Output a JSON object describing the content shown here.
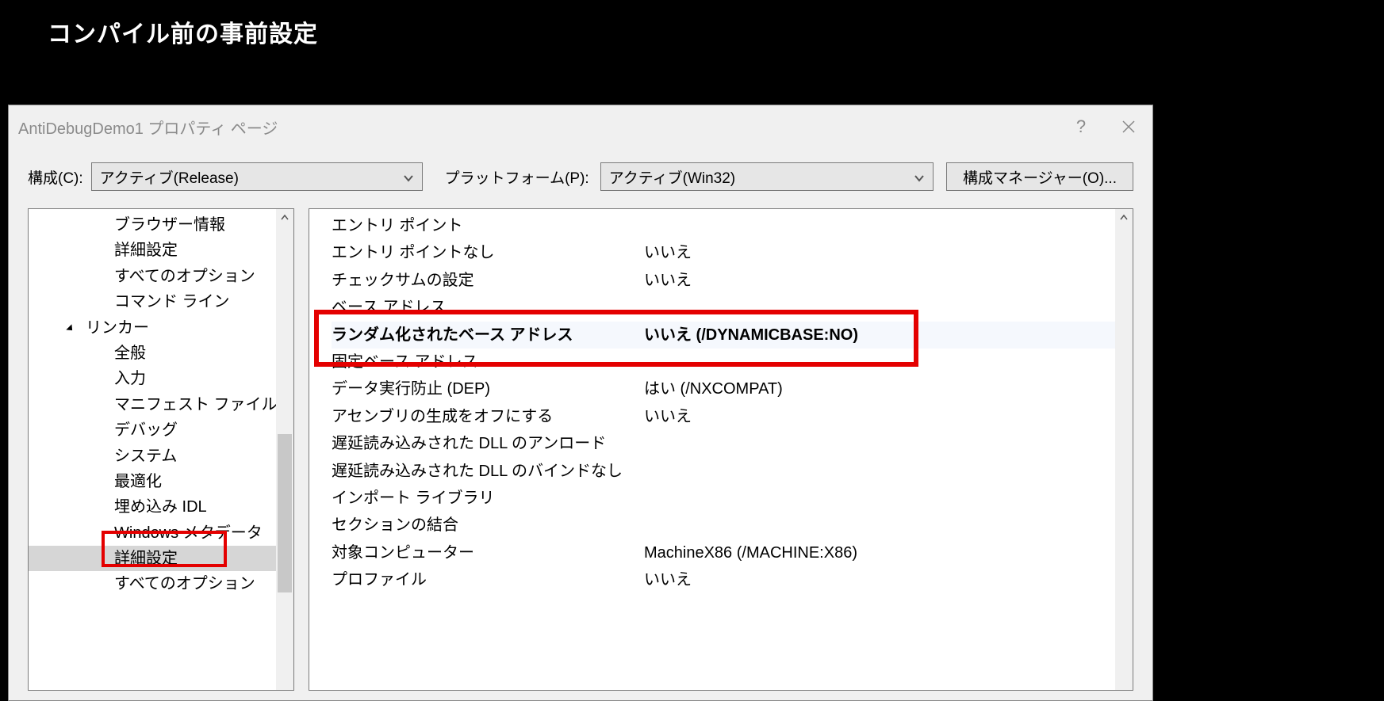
{
  "slide_title": "コンパイル前の事前設定",
  "dialog": {
    "title": "AntiDebugDemo1 プロパティ ページ",
    "help_glyph": "?",
    "config_label": "構成(C):",
    "config_value": "アクティブ(Release)",
    "platform_label": "プラットフォーム(P):",
    "platform_value": "アクティブ(Win32)",
    "config_manager_label": "構成マネージャー(O)..."
  },
  "tree": {
    "items": [
      {
        "label": "ブラウザー情報",
        "indent": 3
      },
      {
        "label": "詳細設定",
        "indent": 3
      },
      {
        "label": "すべてのオプション",
        "indent": 3
      },
      {
        "label": "コマンド ライン",
        "indent": 3
      },
      {
        "label": "リンカー",
        "indent": 2,
        "head": true
      },
      {
        "label": "全般",
        "indent": 3
      },
      {
        "label": "入力",
        "indent": 3
      },
      {
        "label": "マニフェスト ファイル",
        "indent": 3
      },
      {
        "label": "デバッグ",
        "indent": 3
      },
      {
        "label": "システム",
        "indent": 3
      },
      {
        "label": "最適化",
        "indent": 3
      },
      {
        "label": "埋め込み IDL",
        "indent": 3
      },
      {
        "label": "Windows メタデータ",
        "indent": 3
      },
      {
        "label": "詳細設定",
        "indent": 3,
        "selected": true
      },
      {
        "label": "すべてのオプション",
        "indent": 3
      }
    ]
  },
  "props": [
    {
      "label": "エントリ ポイント",
      "value": ""
    },
    {
      "label": "エントリ ポイントなし",
      "value": "いいえ"
    },
    {
      "label": "チェックサムの設定",
      "value": "いいえ"
    },
    {
      "label": "ベース アドレス",
      "value": ""
    },
    {
      "label": "ランダム化されたベース アドレス",
      "value": "いいえ (/DYNAMICBASE:NO)",
      "bold": true,
      "selected": true
    },
    {
      "label": "固定ベース アドレス",
      "value": ""
    },
    {
      "label": "データ実行防止 (DEP)",
      "value": "はい (/NXCOMPAT)"
    },
    {
      "label": "アセンブリの生成をオフにする",
      "value": "いいえ"
    },
    {
      "label": "遅延読み込みされた DLL のアンロード",
      "value": ""
    },
    {
      "label": "遅延読み込みされた DLL のバインドなし",
      "value": ""
    },
    {
      "label": "インポート ライブラリ",
      "value": ""
    },
    {
      "label": "セクションの結合",
      "value": ""
    },
    {
      "label": "対象コンピューター",
      "value": "MachineX86 (/MACHINE:X86)"
    },
    {
      "label": "プロファイル",
      "value": "いいえ"
    }
  ]
}
